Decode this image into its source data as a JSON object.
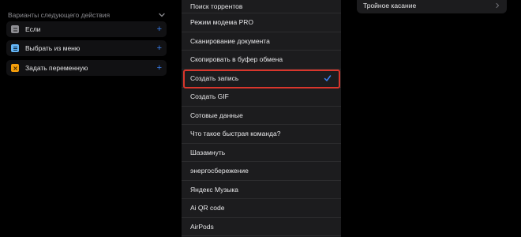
{
  "left": {
    "header": "Варианты следующего действия",
    "actions": [
      {
        "label": "Если",
        "icon": "if-icon",
        "color": "#8e8e93"
      },
      {
        "label": "Выбрать из меню",
        "icon": "menu-icon",
        "color": "#64b5f6"
      },
      {
        "label": "Задать переменную",
        "icon": "variable-icon",
        "color": "#f59e0b"
      }
    ]
  },
  "list": {
    "items": [
      "Поиск торрентов",
      "Режим модема PRO",
      "Сканирование документа",
      "Скопировать в буфер обмена",
      "Создать запись",
      "Создать GIF",
      "Сотовые данные",
      "Что такое быстрая команда?",
      "Шазамнуть",
      "энергосбережение",
      "Яндекс Музыка",
      "Ai QR code",
      "AirPods"
    ],
    "selected_index": 4
  },
  "right": {
    "row_label": "Тройное касание"
  },
  "colors": {
    "accent": "#3b82f6",
    "highlight": "#d9362c"
  }
}
